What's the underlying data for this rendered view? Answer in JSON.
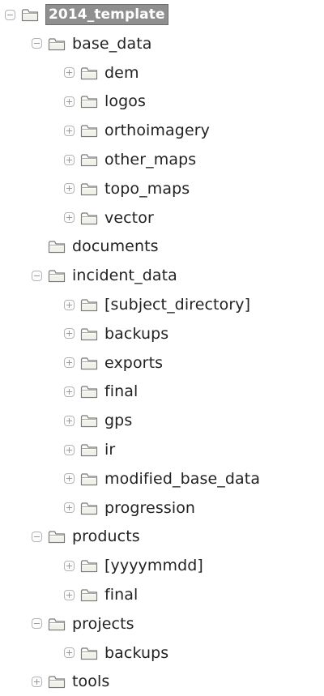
{
  "tree": {
    "nodes": [
      {
        "label": "2014_template",
        "depth": 0,
        "state": "expanded",
        "selected": true
      },
      {
        "label": "base_data",
        "depth": 1,
        "state": "expanded"
      },
      {
        "label": "dem",
        "depth": 2,
        "state": "collapsed"
      },
      {
        "label": "logos",
        "depth": 2,
        "state": "collapsed"
      },
      {
        "label": "orthoimagery",
        "depth": 2,
        "state": "collapsed"
      },
      {
        "label": "other_maps",
        "depth": 2,
        "state": "collapsed"
      },
      {
        "label": "topo_maps",
        "depth": 2,
        "state": "collapsed"
      },
      {
        "label": "vector",
        "depth": 2,
        "state": "collapsed"
      },
      {
        "label": "documents",
        "depth": 1,
        "state": "none"
      },
      {
        "label": "incident_data",
        "depth": 1,
        "state": "expanded"
      },
      {
        "label": "[subject_directory]",
        "depth": 2,
        "state": "collapsed"
      },
      {
        "label": "backups",
        "depth": 2,
        "state": "collapsed"
      },
      {
        "label": "exports",
        "depth": 2,
        "state": "collapsed"
      },
      {
        "label": "final",
        "depth": 2,
        "state": "collapsed"
      },
      {
        "label": "gps",
        "depth": 2,
        "state": "collapsed"
      },
      {
        "label": "ir",
        "depth": 2,
        "state": "collapsed"
      },
      {
        "label": "modified_base_data",
        "depth": 2,
        "state": "collapsed"
      },
      {
        "label": "progression",
        "depth": 2,
        "state": "collapsed"
      },
      {
        "label": "products",
        "depth": 1,
        "state": "expanded"
      },
      {
        "label": "[yyyymmdd]",
        "depth": 2,
        "state": "collapsed"
      },
      {
        "label": "final",
        "depth": 2,
        "state": "collapsed"
      },
      {
        "label": "projects",
        "depth": 1,
        "state": "expanded"
      },
      {
        "label": "backups",
        "depth": 2,
        "state": "collapsed"
      },
      {
        "label": "tools",
        "depth": 1,
        "state": "collapsed"
      }
    ]
  }
}
